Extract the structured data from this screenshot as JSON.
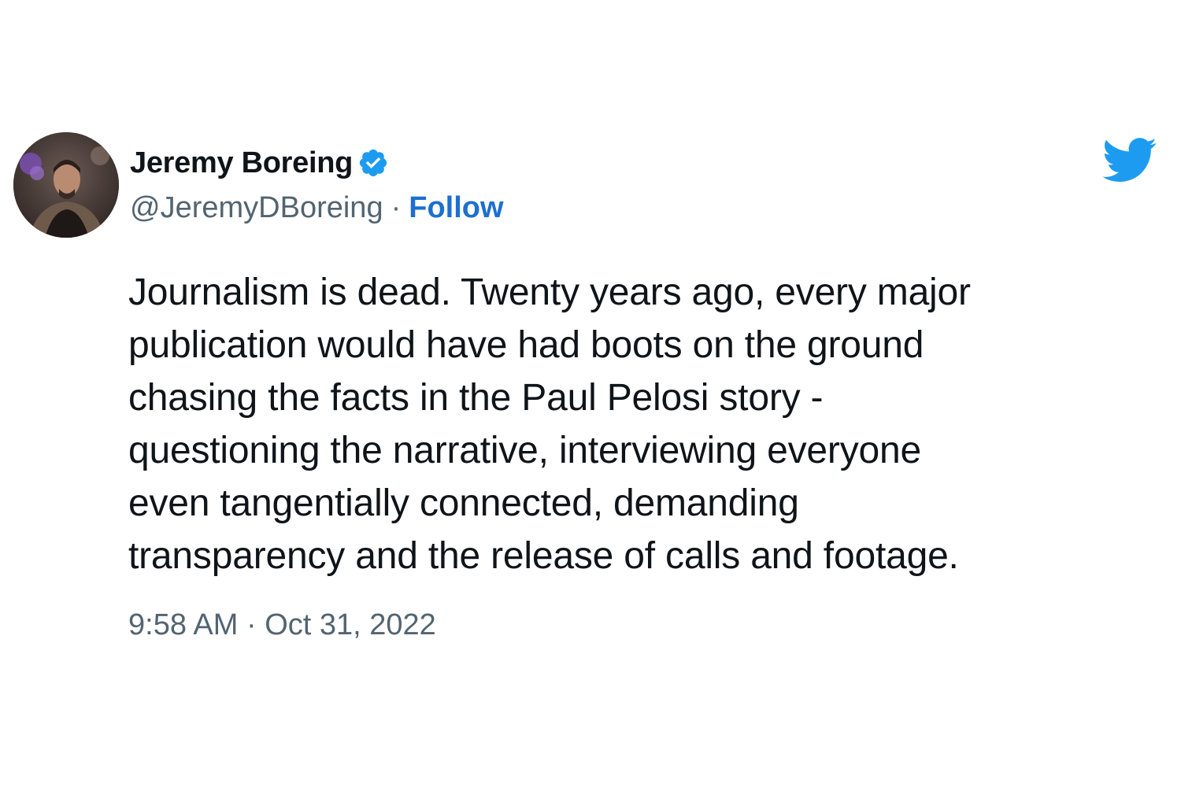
{
  "author": {
    "display_name": "Jeremy Boreing",
    "handle": "@JeremyDBoreing",
    "separator": "·",
    "follow_label": "Follow",
    "verified": true
  },
  "tweet": {
    "text": "Journalism is dead. Twenty years ago, every major\npublication would have had boots on the ground\nchasing the facts in the Paul Pelosi story -\nquestioning the narrative, interviewing everyone\neven tangentially connected, demanding\ntransparency and the release of calls and footage.",
    "timestamp": "9:58 AM · Oct 31, 2022"
  },
  "icons": {
    "verified": "verified-badge-icon",
    "logo": "twitter-bird-icon"
  },
  "colors": {
    "brand_blue": "#1d9bf0",
    "follow_blue": "#1d6fd0",
    "secondary_text": "#536471",
    "primary_text": "#0f1419"
  }
}
